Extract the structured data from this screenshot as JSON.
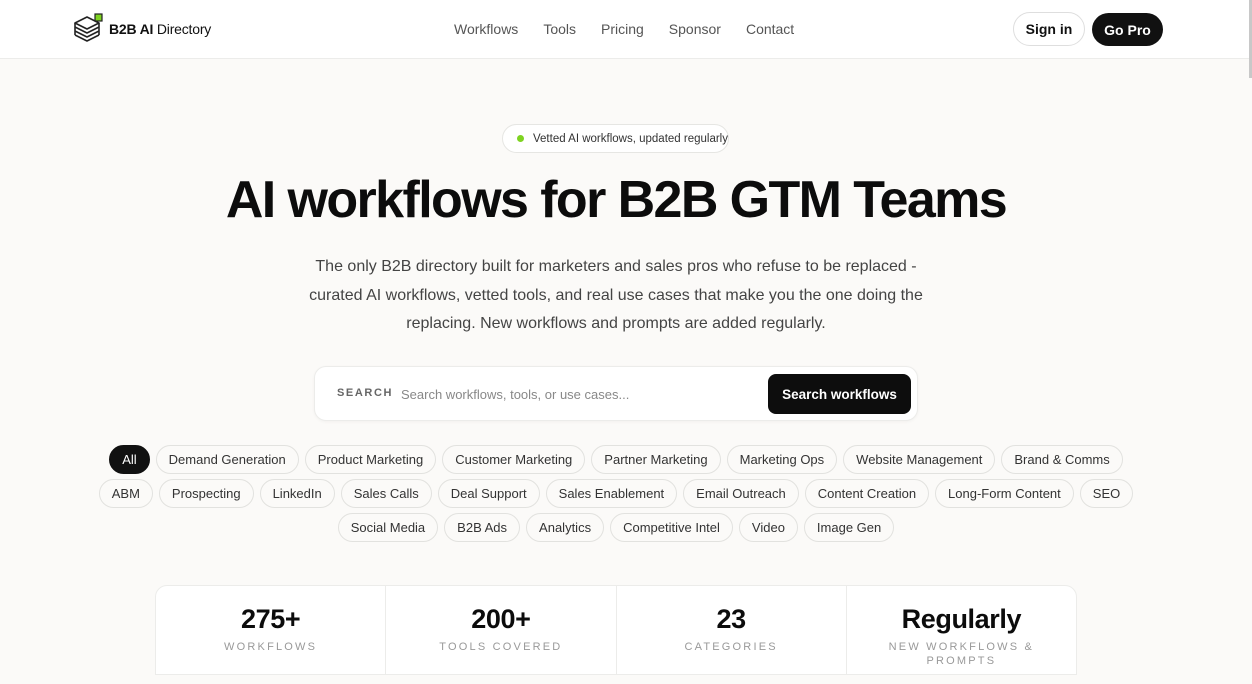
{
  "header": {
    "logo": {
      "bold": "B2B AI",
      "light": " Directory"
    },
    "nav": [
      "Workflows",
      "Tools",
      "Pricing",
      "Sponsor",
      "Contact"
    ],
    "sign_in": "Sign in",
    "go_pro": "Go Pro"
  },
  "hero": {
    "badge": "Vetted AI workflows, updated regularly",
    "title": "AI workflows for B2B GTM Teams",
    "subtitle": "The only B2B directory built for marketers and sales pros who refuse to be replaced - curated AI workflows, vetted tools, and real use cases that make you the one doing the replacing. New workflows and prompts are added regularly."
  },
  "search": {
    "label": "SEARCH",
    "placeholder": "Search workflows, tools, or use cases...",
    "button": "Search workflows"
  },
  "categories": {
    "rows": [
      [
        "All",
        "Demand Generation",
        "Product Marketing",
        "Customer Marketing",
        "Partner Marketing",
        "Marketing Ops",
        "Website Management",
        "Brand & Comms"
      ],
      [
        "ABM",
        "Prospecting",
        "LinkedIn",
        "Sales Calls",
        "Deal Support",
        "Sales Enablement",
        "Email Outreach",
        "Content Creation",
        "Long-Form Content",
        "SEO"
      ],
      [
        "Social Media",
        "B2B Ads",
        "Analytics",
        "Competitive Intel",
        "Video",
        "Image Gen"
      ]
    ],
    "selected": "All"
  },
  "stats": [
    {
      "value": "275+",
      "label": "WORKFLOWS"
    },
    {
      "value": "200+",
      "label": "TOOLS COVERED"
    },
    {
      "value": "23",
      "label": "CATEGORIES"
    },
    {
      "value": "Regularly",
      "label": "NEW WORKFLOWS & PROMPTS"
    }
  ],
  "colors": {
    "accent": "#111111",
    "status_dot": "#7ed321",
    "background": "#fbfaf8"
  }
}
